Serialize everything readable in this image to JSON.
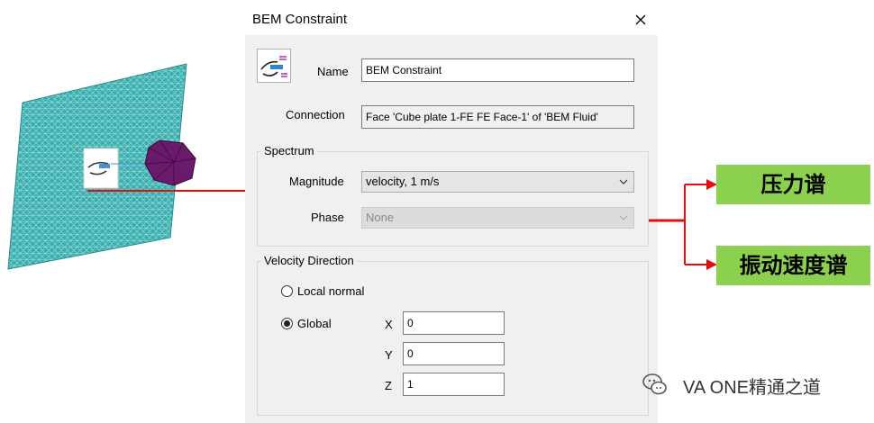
{
  "dialog": {
    "title": "BEM Constraint",
    "name_label": "Name",
    "name_value": "BEM Constraint",
    "connection_label": "Connection",
    "connection_value": "Face 'Cube plate 1-FE FE Face-1' of 'BEM Fluid'",
    "spectrum": {
      "title": "Spectrum",
      "magnitude_label": "Magnitude",
      "magnitude_value": "velocity, 1 m/s",
      "phase_label": "Phase",
      "phase_value": "None"
    },
    "velocity_direction": {
      "title": "Velocity Direction",
      "local_normal_label": "Local normal",
      "global_label": "Global",
      "x_label": "X",
      "x_value": "0",
      "y_label": "Y",
      "y_value": "0",
      "z_label": "Z",
      "z_value": "1"
    }
  },
  "callouts": {
    "pressure_spectrum": "压力谱",
    "vibration_velocity_spectrum": "振动速度谱"
  },
  "watermark": {
    "text": "VA ONE精通之道",
    "icon": "wechat-icon"
  },
  "colors": {
    "plate": "#3aaeae",
    "sphere": "#6a1a6a",
    "arrow": "#e01010",
    "callout_bg": "#8cd050"
  }
}
